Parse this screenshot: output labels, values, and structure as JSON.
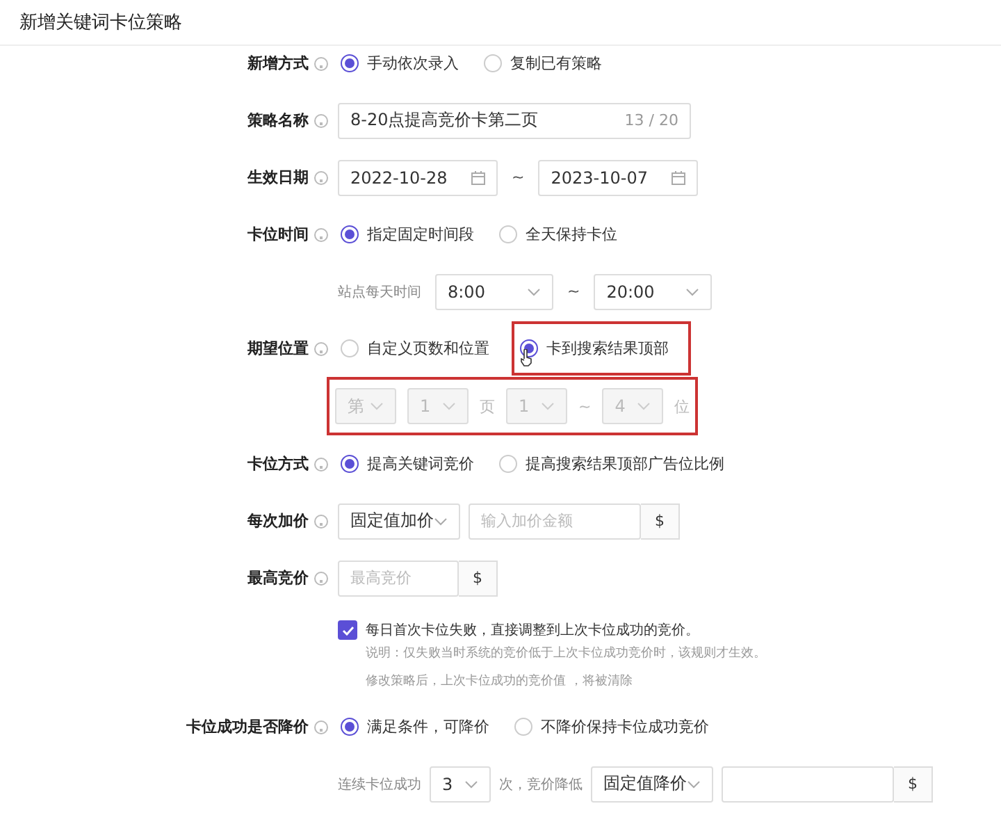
{
  "title": "新增关键词卡位策略",
  "rows": [
    {
      "kind": "radio",
      "label": "新增方式",
      "options": [
        {
          "text": "手动依次录入",
          "selected": true,
          "highlighted": false
        },
        {
          "text": "复制已有策略",
          "selected": false,
          "highlighted": false
        }
      ]
    },
    {
      "kind": "input",
      "label": "策略名称",
      "value": "8-20点提高竞价卡第二页",
      "counter": "13 / 20"
    },
    {
      "kind": "daterange",
      "label": "生效日期",
      "start": "2022-10-28",
      "separator": "~",
      "end": "2023-10-07"
    },
    {
      "kind": "radio",
      "label": "卡位时间",
      "options": [
        {
          "text": "指定固定时间段",
          "selected": true,
          "highlighted": false
        },
        {
          "text": "全天保持卡位",
          "selected": false,
          "highlighted": false
        }
      ]
    },
    {
      "kind": "timerange",
      "caption": "站点每天时间",
      "start": "8:00",
      "separator": "~",
      "end": "20:00"
    },
    {
      "kind": "radio",
      "label": "期望位置",
      "cursor": true,
      "options": [
        {
          "text": "自定义页数和位置",
          "selected": false,
          "highlighted": false
        },
        {
          "text": "卡到搜索结果顶部",
          "selected": true,
          "highlighted": true
        }
      ]
    },
    {
      "kind": "position",
      "highlighted": true,
      "disabled": true,
      "parts": [
        {
          "kind": "select",
          "text": "第"
        },
        {
          "kind": "select",
          "text": "1"
        },
        {
          "kind": "text",
          "text": "页"
        },
        {
          "kind": "select",
          "text": "1"
        },
        {
          "kind": "text",
          "text": "~"
        },
        {
          "kind": "select",
          "text": "4"
        },
        {
          "kind": "text",
          "text": "位"
        }
      ]
    },
    {
      "kind": "radio",
      "label": "卡位方式",
      "options": [
        {
          "text": "提高关键词竞价",
          "selected": true,
          "highlighted": false
        },
        {
          "text": "提高搜索结果顶部广告位比例",
          "selected": false,
          "highlighted": false
        }
      ]
    },
    {
      "kind": "select_input",
      "label": "每次加价",
      "select": "固定值加价",
      "placeholder": "输入加价金额",
      "addon": "$"
    },
    {
      "kind": "input_addon",
      "label": "最高竞价",
      "placeholder": "最高竞价",
      "addon": "$"
    },
    {
      "kind": "checkbox",
      "checked": true,
      "text": "每日首次卡位失败，直接调整到上次卡位成功的竞价。",
      "notes": [
        "说明：仅失败当时系统的竞价低于上次卡位成功竞价时，该规则才生效。",
        "修改策略后，上次卡位成功的竞价值 ，将被清除"
      ]
    },
    {
      "kind": "radio",
      "label": "卡位成功是否降价",
      "options": [
        {
          "text": "满足条件，可降价",
          "selected": true,
          "highlighted": false
        },
        {
          "text": "不降价保持卡位成功竞价",
          "selected": false,
          "highlighted": false
        }
      ]
    },
    {
      "kind": "steps",
      "caption": "连续卡位成功",
      "count": "3",
      "middle": "次，竞价降低",
      "select": "固定值降价",
      "addon": "$"
    }
  ]
}
